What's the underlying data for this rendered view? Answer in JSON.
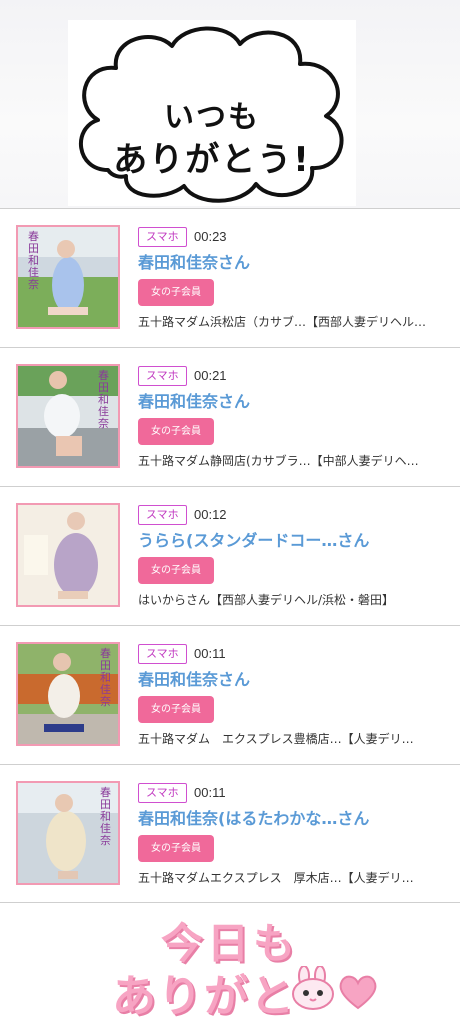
{
  "top_banner": {
    "line1": "いつも",
    "line2": "ありがとう!"
  },
  "entries": [
    {
      "badge": "スマホ",
      "time": "00:23",
      "name": "春田和佳奈さん",
      "member_label": "女の子会員",
      "shop": "五十路マダム浜松店（カサブ…【西部人妻デリヘル…",
      "thumb_text": "春田和佳奈"
    },
    {
      "badge": "スマホ",
      "time": "00:21",
      "name": "春田和佳奈さん",
      "member_label": "女の子会員",
      "shop": "五十路マダム静岡店(カサブラ…【中部人妻デリヘ…",
      "thumb_text": "春田和佳奈"
    },
    {
      "badge": "スマホ",
      "time": "00:12",
      "name": "うらら(スタンダードコー…さん",
      "member_label": "女の子会員",
      "shop": "はいからさん【西部人妻デリヘル/浜松・磐田】",
      "thumb_text": ""
    },
    {
      "badge": "スマホ",
      "time": "00:11",
      "name": "春田和佳奈さん",
      "member_label": "女の子会員",
      "shop": "五十路マダム　エクスプレス豊橋店…【人妻デリ…",
      "thumb_text": "春田和佳奈"
    },
    {
      "badge": "スマホ",
      "time": "00:11",
      "name": "春田和佳奈(はるたわかな…さん",
      "member_label": "女の子会員",
      "shop": "五十路マダムエクスプレス　厚木店…【人妻デリ…",
      "thumb_text": "春田和佳奈"
    }
  ],
  "bottom_banner": {
    "line1": "今日も",
    "line2": "ありがと"
  },
  "colors": {
    "accent_pink": "#f0699a",
    "name_blue": "#5a9ad6",
    "badge_purple": "#c13bc1",
    "thumb_border": "#f29ab3"
  }
}
